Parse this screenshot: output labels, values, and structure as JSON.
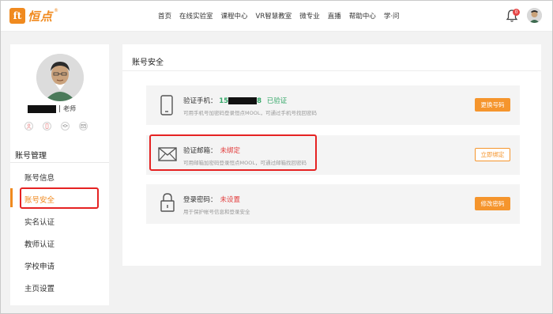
{
  "header": {
    "logo_badge": "ft",
    "logo_text": "恒点",
    "logo_reg": "®",
    "nav": [
      "首页",
      "在线实验室",
      "课程中心",
      "VR智慧教室",
      "微专业",
      "直播",
      "帮助中心",
      "学·问"
    ],
    "notification_count": "0"
  },
  "sidebar": {
    "role": "老师",
    "section_title": "账号管理",
    "items": [
      "账号信息",
      "账号安全",
      "实名认证",
      "教师认证",
      "学校申请",
      "主页设置"
    ],
    "active_item": "账号安全"
  },
  "main": {
    "title": "账号安全",
    "rows": [
      {
        "label": "验证手机：",
        "value_prefix": "15",
        "value_suffix": "8",
        "status": "已验证",
        "description": "可用手机号加密码登录恒点MOOL，可通过手机号找回密码",
        "button": "更换号码"
      },
      {
        "label": "验证邮箱：",
        "status": "未绑定",
        "description": "可用邮箱加密码登录恒点MOOL，可通过邮箱找回密码",
        "button": "立即绑定"
      },
      {
        "label": "登录密码：",
        "status": "未设置",
        "description": "用于保护帐号信息和登录安全",
        "button": "修改密码"
      }
    ]
  },
  "colors": {
    "accent": "#f5952d",
    "success": "#36a86a",
    "warning": "#e23c3c",
    "highlight_box": "#e52222"
  }
}
